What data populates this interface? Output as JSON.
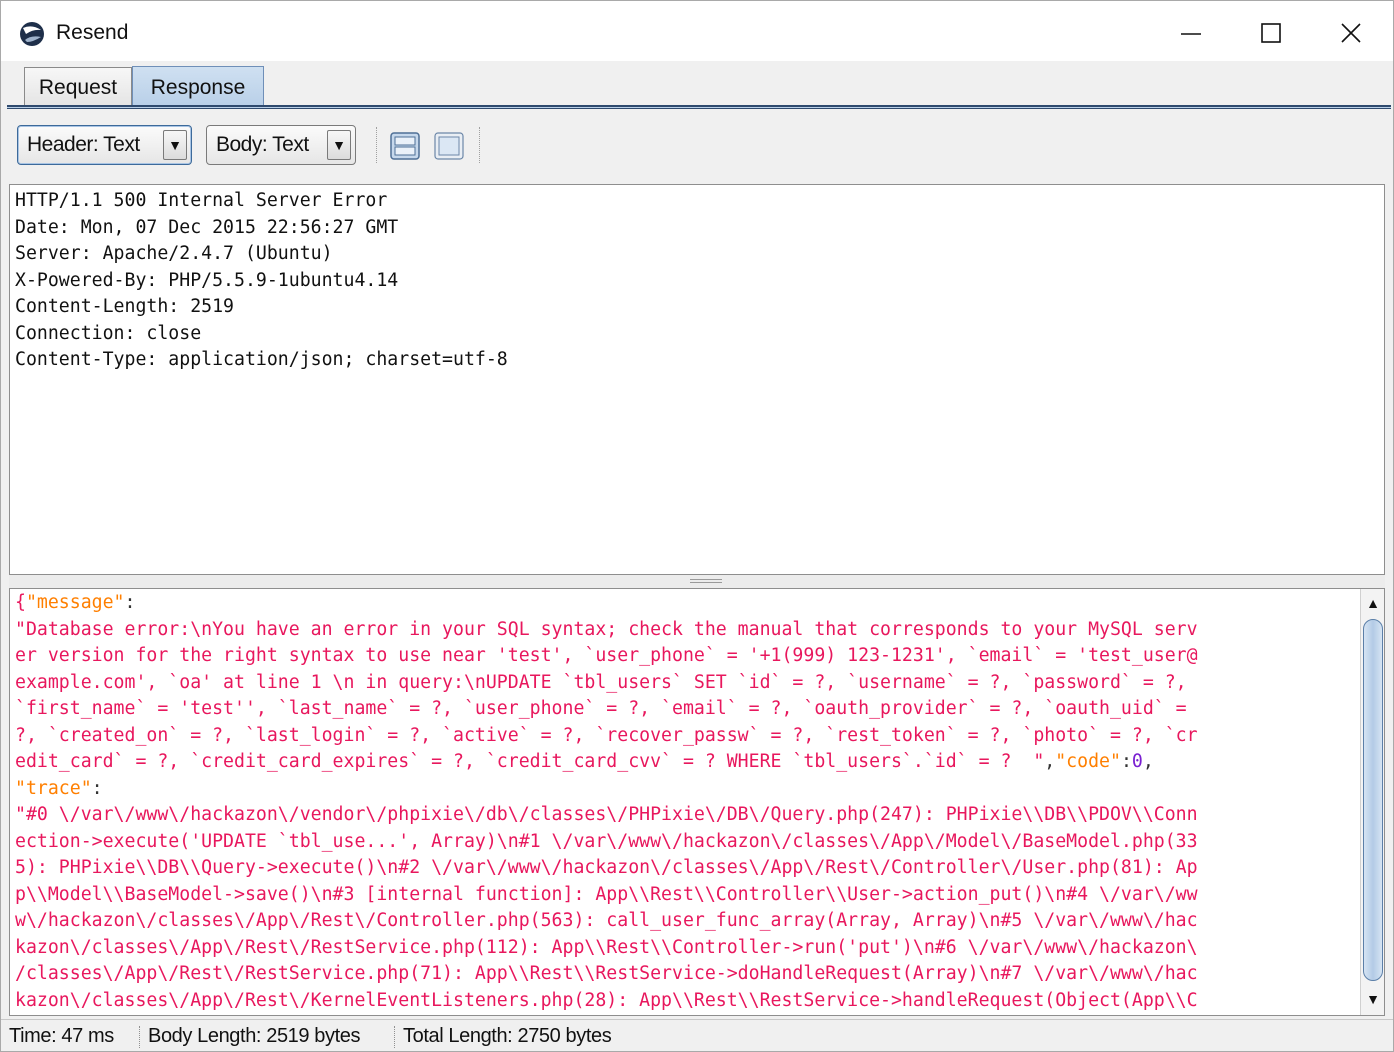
{
  "window": {
    "title": "Resend",
    "icons": {
      "app": "globe-icon",
      "minimize": "minimize-icon",
      "maximize": "maximize-icon",
      "close": "close-icon"
    }
  },
  "tabs": [
    {
      "label": "Request",
      "selected": false
    },
    {
      "label": "Response",
      "selected": true
    }
  ],
  "toolbar": {
    "header_view": "Header: Text",
    "body_view": "Body: Text",
    "layout_icons": [
      "split-vertical-icon",
      "split-horizontal-icon"
    ]
  },
  "response_header": {
    "lines": [
      "HTTP/1.1 500 Internal Server Error",
      "Date: Mon, 07 Dec 2015 22:56:27 GMT",
      "Server: Apache/2.4.7 (Ubuntu)",
      "X-Powered-By: PHP/5.5.9-1ubuntu4.14",
      "Content-Length: 2519",
      "Connection: close",
      "Content-Type: application/json; charset=utf-8"
    ]
  },
  "response_body": {
    "l0_brace": "{",
    "l0_key": "\"message\"",
    "l0_colon": ":",
    "l1": "\"Database error:\\nYou have an error in your SQL syntax; check the manual that corresponds to your MySQL serv",
    "l2": "er version for the right syntax to use near 'test', `user_phone` = '+1(999) 123-1231', `email` = 'test_user@",
    "l3": "example.com', `oa' at line 1 \\n in query:\\nUPDATE `tbl_users` SET `id` = ?, `username` = ?, `password` = ?,",
    "l4": "`first_name` = 'test'', `last_name` = ?, `user_phone` = ?, `email` = ?, `oauth_provider` = ?, `oauth_uid` =",
    "l5": "?, `created_on` = ?, `last_login` = ?, `active` = ?, `recover_passw` = ?, `rest_token` = ?, `photo` = ?, `cr",
    "l6_text": "edit_card` = ?, `credit_card_expires` = ?, `credit_card_cvv` = ? WHERE `tbl_users`.`id` = ?  \"",
    "l6_comma": ",",
    "l6_key": "\"code\"",
    "l6_colon": ":",
    "l6_num": "0",
    "l6_end": ",",
    "l7_key": "\"trace\"",
    "l7_colon": ":",
    "l8": "\"#0 \\/var\\/www\\/hackazon\\/vendor\\/phpixie\\/db\\/classes\\/PHPixie\\/DB\\/Query.php(247): PHPixie\\\\DB\\\\PDOV\\\\Conn",
    "l9": "ection->execute('UPDATE `tbl_use...', Array)\\n#1 \\/var\\/www\\/hackazon\\/classes\\/App\\/Model\\/BaseModel.php(33",
    "l10": "5): PHPixie\\\\DB\\\\Query->execute()\\n#2 \\/var\\/www\\/hackazon\\/classes\\/App\\/Rest\\/Controller\\/User.php(81): Ap",
    "l11": "p\\\\Model\\\\BaseModel->save()\\n#3 [internal function]: App\\\\Rest\\\\Controller\\\\User->action_put()\\n#4 \\/var\\/ww",
    "l12": "w\\/hackazon\\/classes\\/App\\/Rest\\/Controller.php(563): call_user_func_array(Array, Array)\\n#5 \\/var\\/www\\/hac",
    "l13": "kazon\\/classes\\/App\\/Rest\\/RestService.php(112): App\\\\Rest\\\\Controller->run('put')\\n#6 \\/var\\/www\\/hackazon\\",
    "l14": "/classes\\/App\\/Rest\\/RestService.php(71): App\\\\Rest\\\\RestService->doHandleRequest(Array)\\n#7 \\/var\\/www\\/hac",
    "l15": "kazon\\/classes\\/App\\/Rest\\/KernelEventListeners.php(28): App\\\\Rest\\\\RestService->handleRequest(Object(App\\\\C"
  },
  "status": {
    "time": "Time: 47 ms",
    "body_length": "Body Length: 2519 bytes",
    "total_length": "Total Length: 2750 bytes"
  },
  "colors": {
    "body_text": "#e8175d",
    "json_key": "#ff7f00",
    "json_number": "#7a1fd1",
    "selected_tab": "#b8cfe8"
  }
}
